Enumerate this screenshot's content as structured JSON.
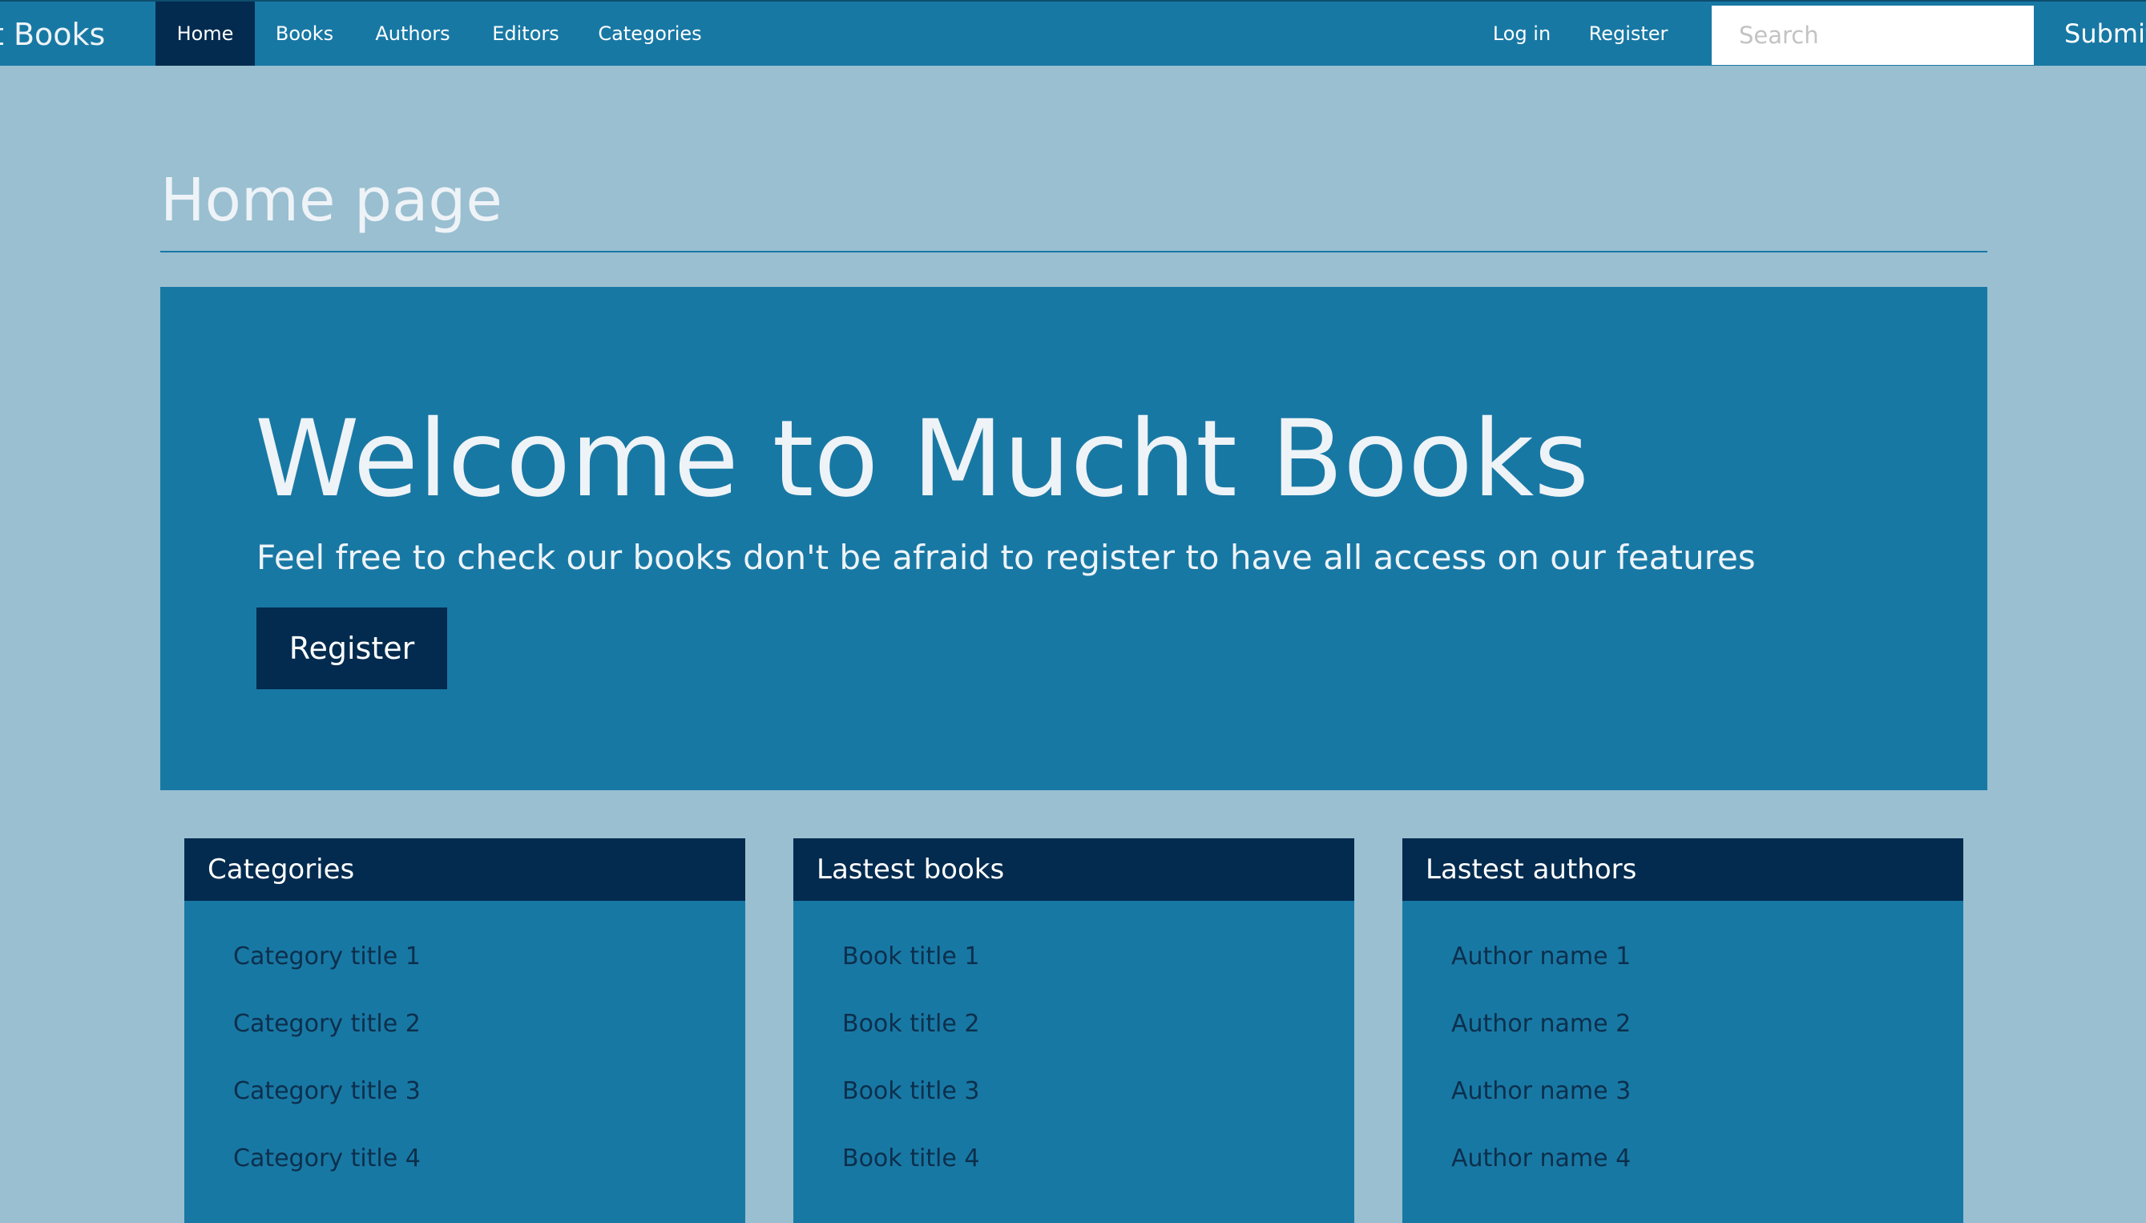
{
  "nav": {
    "brand": "cht Books",
    "items": [
      {
        "label": "Home",
        "active": true
      },
      {
        "label": "Books"
      },
      {
        "label": "Authors"
      },
      {
        "label": "Editors"
      },
      {
        "label": "Categories"
      }
    ],
    "login": "Log in",
    "register": "Register",
    "search_placeholder": "Search",
    "submit": "Submit"
  },
  "page": {
    "title": "Home page"
  },
  "hero": {
    "title": "Welcome to Mucht Books",
    "subtitle": "Feel free to check our books don't be afraid to register to have all access on our features",
    "button": "Register"
  },
  "panels": [
    {
      "title": "Categories",
      "items": [
        "Category title 1",
        "Category title 2",
        "Category title 3",
        "Category title 4"
      ]
    },
    {
      "title": "Lastest books",
      "items": [
        "Book title 1",
        "Book title 2",
        "Book title 3",
        "Book title 4"
      ]
    },
    {
      "title": "Lastest authors",
      "items": [
        "Author name 1",
        "Author name 2",
        "Author name 3",
        "Author name 4"
      ]
    }
  ],
  "colors": {
    "background": "#99bfd1",
    "primary": "#1878a4",
    "dark": "#022b4f",
    "light_text": "#eef3f7",
    "list_text": "#0c2f4c"
  }
}
